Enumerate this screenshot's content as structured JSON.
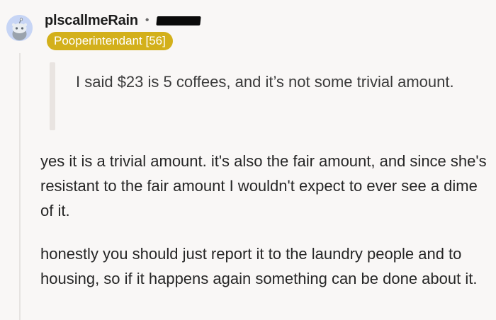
{
  "comment": {
    "username": "plscallmeRain",
    "separator": "•",
    "flair": "Pooperintendant [56]",
    "quote": "I said $23 is 5 coffees, and it’s not some trivial amount.",
    "paragraphs": [
      "yes it is a trivial amount. it's also the fair amount, and since she's resistant to the fair amount I wouldn't expect to ever see a dime of it.",
      "honestly you should just report it to the laundry people and to housing, so if it happens again something can be done about it."
    ]
  },
  "colors": {
    "background": "#f9f7f6",
    "flair": "#d3b01b",
    "avatar": "#c7d5f5",
    "quote_bar": "#e9e4e1"
  },
  "icons": {
    "avatar": "snoo-avatar-icon"
  }
}
